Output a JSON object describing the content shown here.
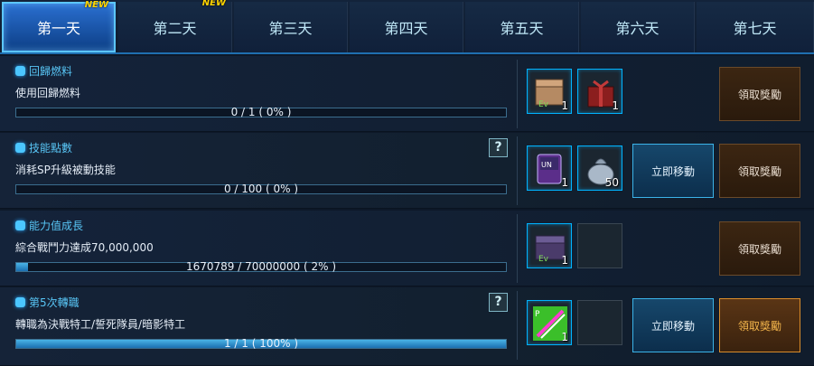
{
  "tabs": [
    {
      "label": "第一天",
      "new": "NEW",
      "active": true
    },
    {
      "label": "第二天",
      "new": "NEW",
      "active": false
    },
    {
      "label": "第三天",
      "new": "",
      "active": false
    },
    {
      "label": "第四天",
      "new": "",
      "active": false
    },
    {
      "label": "第五天",
      "new": "",
      "active": false
    },
    {
      "label": "第六天",
      "new": "",
      "active": false
    },
    {
      "label": "第七天",
      "new": "",
      "active": false
    }
  ],
  "missions": [
    {
      "title": "回歸燃料",
      "desc": "使用回歸燃料",
      "progress_text": "0 / 1 ( 0% )",
      "progress": 0,
      "help": "",
      "rewards": [
        {
          "icon": "box-icon",
          "qty": "1"
        },
        {
          "icon": "gift-icon",
          "qty": "1"
        }
      ],
      "move_label": "",
      "claim_label": "領取獎勵",
      "claim_ready": false
    },
    {
      "title": "技能點數",
      "desc": "消耗SP升級被動技能",
      "progress_text": "0 / 100 ( 0% )",
      "progress": 0,
      "help": "?",
      "rewards": [
        {
          "icon": "card-icon",
          "qty": "1"
        },
        {
          "icon": "sack-icon",
          "qty": "50"
        }
      ],
      "move_label": "立即移動",
      "claim_label": "領取獎勵",
      "claim_ready": false
    },
    {
      "title": "能力值成長",
      "desc": "綜合戰鬥力達成70,000,000",
      "progress_text": "1670789 / 70000000 ( 2% )",
      "progress": 0.024,
      "help": "",
      "rewards": [
        {
          "icon": "chest-icon",
          "qty": "1"
        },
        {
          "icon": "empty-slot",
          "qty": ""
        }
      ],
      "move_label": "",
      "claim_label": "領取獎勵",
      "claim_ready": false
    },
    {
      "title": "第5次轉職",
      "desc": "轉職為決戰特工/誓死隊員/暗影特工",
      "progress_text": "1 / 1 ( 100% )",
      "progress": 1,
      "help": "?",
      "rewards": [
        {
          "icon": "sword-icon",
          "qty": "1"
        },
        {
          "icon": "empty-slot",
          "qty": ""
        }
      ],
      "move_label": "立即移動",
      "claim_label": "領取獎勵",
      "claim_ready": true
    }
  ]
}
